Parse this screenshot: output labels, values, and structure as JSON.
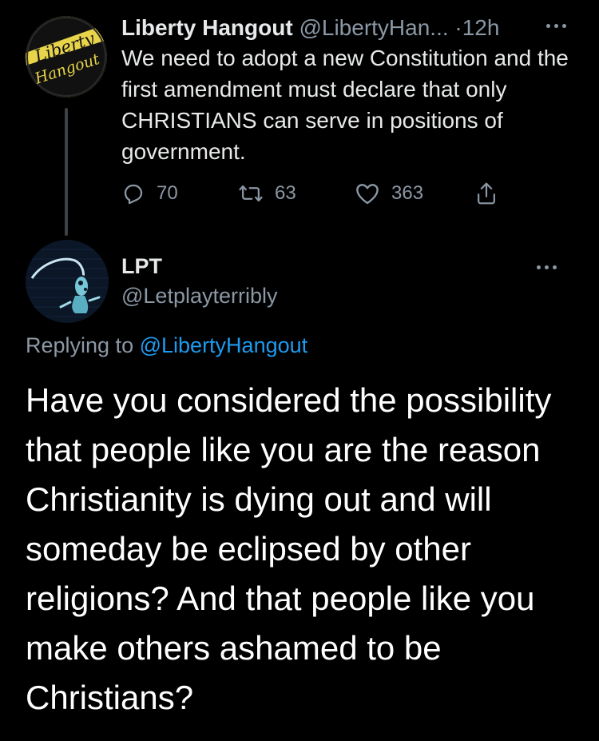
{
  "original_tweet": {
    "display_name": "Liberty Hangout",
    "handle_truncated": "@LibertyHan...",
    "separator": "·",
    "time": "12h",
    "text": "We need to adopt a new Constitution and the first amendment must declare that only CHRISTIANS can serve in positions of government.",
    "avatar_text_line1": "Liberty",
    "avatar_text_line2": "Hangout",
    "actions": {
      "replies": "70",
      "retweets": "63",
      "likes": "363"
    }
  },
  "reply_tweet": {
    "display_name": "LPT",
    "handle": "@Letplayterribly",
    "replying_prefix": "Replying to",
    "replying_to": "@LibertyHangout",
    "text": "Have you considered the possibility that people like you are the reason Christianity is dying out and will someday be eclipsed by other religions? And that people like you make others ashamed to be Christians?"
  },
  "colors": {
    "background": "#000000",
    "primary_text": "#e7e9ea",
    "secondary_text": "#8b98a5",
    "link": "#1d9bf0",
    "logo_yellow": "#e7d44a"
  },
  "icons": [
    "more-icon",
    "reply-icon",
    "retweet-icon",
    "like-icon",
    "share-icon"
  ]
}
